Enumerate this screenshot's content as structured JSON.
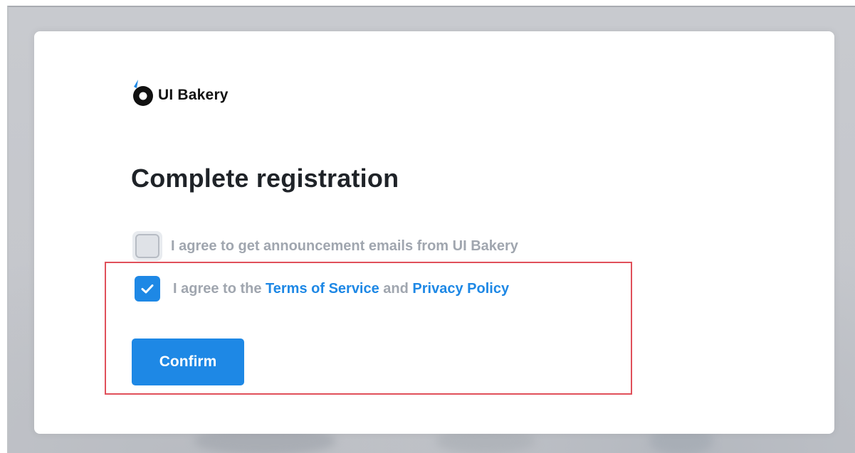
{
  "brand": {
    "name": "UI Bakery",
    "icon": "ui-bakery-logo-icon",
    "accent_color": "#1e88e5"
  },
  "form": {
    "title": "Complete registration",
    "announcement_checkbox": {
      "label": "I agree to get announcement emails from UI Bakery",
      "checked": false
    },
    "terms_checkbox": {
      "checked": true,
      "label_prefix": "I agree to the ",
      "terms_link": "Terms of Service",
      "conjunction": " and ",
      "privacy_link": "Privacy Policy"
    },
    "confirm_label": "Confirm"
  },
  "annotation": {
    "highlight_color": "#e0505a"
  }
}
